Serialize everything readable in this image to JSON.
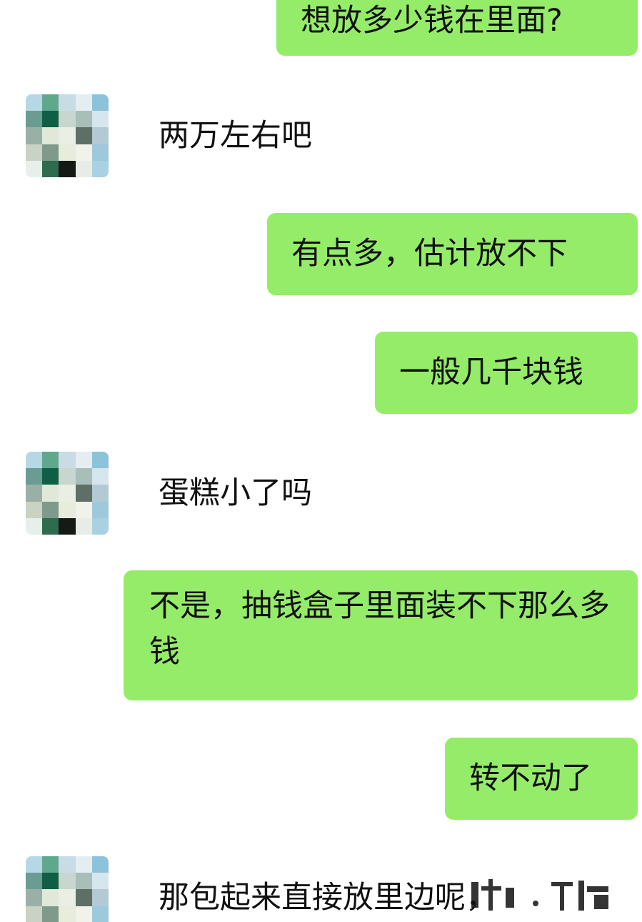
{
  "messages": [
    {
      "side": "out",
      "text": "想放多少钱在里面?"
    },
    {
      "side": "in",
      "text": "两万左右吧"
    },
    {
      "side": "out",
      "text": "有点多，估计放不下"
    },
    {
      "side": "out",
      "text": "一般几千块钱"
    },
    {
      "side": "in",
      "text": "蛋糕小了吗"
    },
    {
      "side": "out",
      "text": "不是，抽钱盒子里面装不下那么多钱"
    },
    {
      "side": "out",
      "text": "转不动了"
    },
    {
      "side": "in",
      "text": "那包起来直接放里边呢，"
    }
  ],
  "colors": {
    "bubble_out": "#95ec69",
    "background": "#ffffff",
    "text": "#111111"
  },
  "icons": {
    "contact_avatar": "pixelated-avatar-icon"
  }
}
